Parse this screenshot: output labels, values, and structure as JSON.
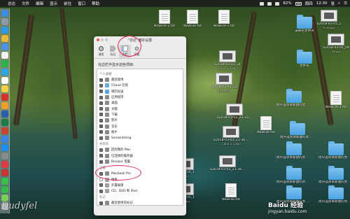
{
  "menubar": {
    "items": [
      "访达",
      "文件",
      "编辑",
      "显示",
      "前往",
      "窗口",
      "帮助"
    ],
    "clock": "12:30",
    "day": "周四",
    "user": "张",
    "battery": "82%"
  },
  "dock": {
    "apps": [
      {
        "name": "finder",
        "color": "#3b8fe0"
      },
      {
        "name": "launchpad",
        "color": "#8f9aa7"
      },
      {
        "name": "safari",
        "color": "#2e9be6"
      },
      {
        "name": "chrome",
        "color": "#e8b83a"
      },
      {
        "name": "mail",
        "color": "#4b95e8"
      },
      {
        "name": "photos",
        "color": "#f2f2f2"
      },
      {
        "name": "wechat",
        "color": "#2cb14c"
      },
      {
        "name": "qq",
        "color": "#2aa7e8"
      },
      {
        "name": "calendar",
        "color": "#ffffff"
      },
      {
        "name": "notes",
        "color": "#f4d04a"
      },
      {
        "name": "netease-music",
        "color": "#d8302a"
      },
      {
        "name": "pages",
        "color": "#f29f2d"
      },
      {
        "name": "word",
        "color": "#2a5ea8"
      },
      {
        "name": "excel",
        "color": "#1f7a43"
      },
      {
        "name": "powerpoint",
        "color": "#c8452b"
      },
      {
        "name": "baidu-netdisk",
        "color": "#3a85e6"
      },
      {
        "name": "app-store",
        "color": "#1e8ff0"
      },
      {
        "name": "system-preferences",
        "color": "#8a8a8a"
      },
      {
        "name": "vivaldi",
        "color": "#e0393e"
      },
      {
        "name": "wps",
        "color": "#c8362f"
      },
      {
        "name": "messages",
        "color": "#39c04a"
      },
      {
        "name": "facetime",
        "color": "#35b948"
      },
      {
        "name": "maps",
        "color": "#7ccf5a"
      },
      {
        "name": "trash",
        "color": "#c9ced4"
      }
    ]
  },
  "desktop_icons": [
    {
      "name": "NewFile-2.txt",
      "kind": "doc"
    },
    {
      "name": "NewFile.txt",
      "kind": "doc"
    },
    {
      "name": "NewFile-1.txt",
      "kind": "doc"
    },
    {
      "name": "a2018-03-05_1",
      "sub": "9-46.jpg",
      "kind": "shot"
    },
    {
      "name": "a2018-03-05_09",
      "sub": "46.jpg",
      "kind": "shot"
    },
    {
      "name": "a2018-03-03_24",
      "sub": "1,800 × 1,600",
      "kind": "shot"
    },
    {
      "name": "s2018-03-03_22",
      "sub": "29-58.jpg",
      "kind": "shot"
    },
    {
      "name": "未命名文件夹",
      "kind": "folder"
    },
    {
      "name": "文件夹",
      "kind": "folder"
    },
    {
      "name": "a2018-03-03_22-35-53.jpg",
      "kind": "shot"
    },
    {
      "name": "周兴选项目新建的文件夹 2",
      "kind": "folder"
    },
    {
      "name": "NewFile-3.txt",
      "kind": "doc"
    },
    {
      "name": "a2018-03-03_21-36-09.jpg",
      "sub": "1,800 × 1,600",
      "kind": "shot"
    },
    {
      "name": "NewFile.txt",
      "kind": "doc"
    },
    {
      "name": "周兴选项目新建的文件夹 1",
      "kind": "folder"
    },
    {
      "name": "a2018-03-03_21-36-09.jpg",
      "kind": "shot"
    },
    {
      "name": "周兴选项目新建的文件夹 10",
      "kind": "folder"
    },
    {
      "name": "周兴选项目新建的文件夹 9",
      "kind": "folder"
    },
    {
      "name": "周兴选项目新建的文件夹 8",
      "kind": "folder"
    },
    {
      "name": "周兴选项目新建的文件夹 7",
      "kind": "folder"
    },
    {
      "name": "18-03-06_1",
      "sub": "6.jpg",
      "kind": "shot"
    },
    {
      "name": "18-03-05_1",
      "sub": "25.jpg",
      "kind": "shot"
    },
    {
      "name": "NewFile.txt",
      "kind": "doc"
    },
    {
      "name": "周兴选项目新建的文件夹",
      "kind": "folder"
    },
    {
      "name": "周兴选项目新建的文件夹",
      "kind": "folder"
    }
  ],
  "prefs": {
    "title": "\"访达\"偏好设置",
    "tabs": [
      {
        "label": "通用",
        "active": false
      },
      {
        "label": "标记",
        "active": false
      },
      {
        "label": "边栏",
        "active": true
      },
      {
        "label": "高级",
        "active": false
      }
    ],
    "prompt": "在边栏中显示这些项目:",
    "groups": [
      {
        "header": "个人收藏",
        "items": [
          {
            "label": "最近使用",
            "checked": true,
            "icon_color": "#8a8a8a"
          },
          {
            "label": "iCloud 云盘",
            "checked": true,
            "icon_color": "#6aa8e0"
          },
          {
            "label": "隔空投送",
            "checked": true,
            "icon_color": "#5aa2e0"
          },
          {
            "label": "应用程序",
            "checked": true,
            "icon_color": "#8a8a8a"
          },
          {
            "label": "桌面",
            "checked": true,
            "icon_color": "#8a8a8a"
          },
          {
            "label": "文稿",
            "checked": true,
            "icon_color": "#8a8a8a"
          },
          {
            "label": "下载",
            "checked": true,
            "icon_color": "#8a8a8a"
          },
          {
            "label": "影片",
            "checked": true,
            "icon_color": "#8a8a8a"
          },
          {
            "label": "音乐",
            "checked": true,
            "icon_color": "#8a8a8a"
          },
          {
            "label": "图片",
            "checked": true,
            "icon_color": "#8a8a8a"
          },
          {
            "label": "Sansenblang",
            "checked": true,
            "icon_color": "#8a8a8a"
          }
        ]
      },
      {
        "header": "共享的",
        "items": [
          {
            "label": "回到我的 Mac",
            "checked": true,
            "icon_color": "#8a8a8a"
          },
          {
            "label": "已连接的服务器",
            "checked": true,
            "icon_color": "#8a8a8a"
          },
          {
            "label": "Bonjour 电脑",
            "checked": true,
            "icon_color": "#8a8a8a"
          }
        ]
      },
      {
        "header": "设备",
        "items": [
          {
            "label": "Macbook Pro",
            "checked": true,
            "icon_color": "#8a8a8a"
          },
          {
            "label": "硬盘",
            "checked": false,
            "icon_color": "#a0a0a0"
          },
          {
            "label": "外置磁盘",
            "checked": true,
            "icon_color": "#a0a0a0"
          },
          {
            "label": "CD、DVD 和 iPod",
            "checked": true,
            "icon_color": "#a0a0a0"
          }
        ]
      },
      {
        "header": "标记",
        "items": [
          {
            "label": "最近使用的标记",
            "checked": true,
            "icon_color": "#8a8a8a"
          }
        ]
      }
    ]
  },
  "watermark": {
    "signature": "Dudyfel",
    "brand": "Baidu 经验",
    "domain": "jingyan.baidu.com"
  },
  "colors": {
    "accent": "#3a73c8",
    "annotation": "#e3245a",
    "folder": "#4aa2e2"
  }
}
